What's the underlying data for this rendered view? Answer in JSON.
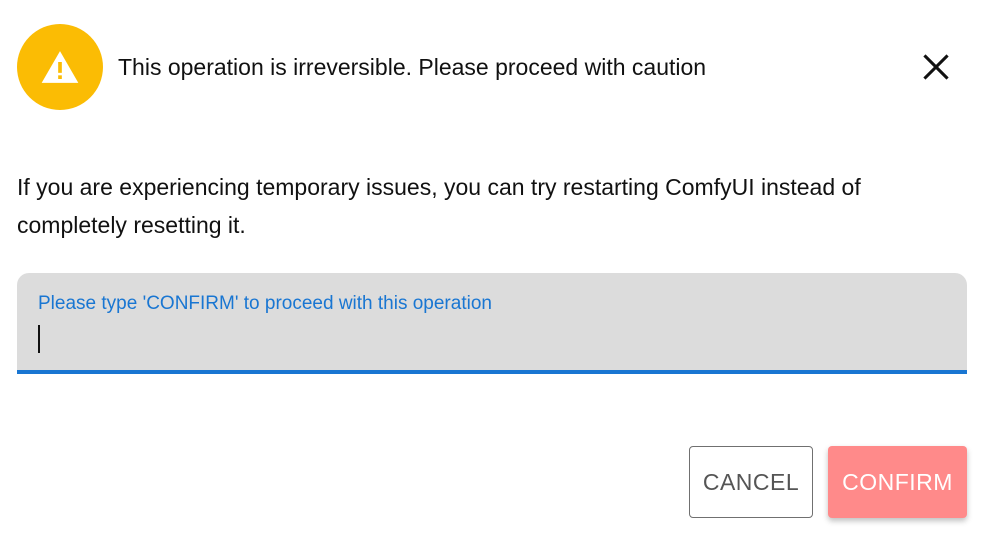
{
  "dialog": {
    "title": "This operation is irreversible. Please proceed with caution",
    "message": "If you are experiencing temporary issues, you can try restarting ComfyUI instead of completely resetting it.",
    "warning_icon": "warning-icon",
    "close_icon": "close-icon"
  },
  "confirm_field": {
    "label": "Please type 'CONFIRM' to proceed with this operation",
    "value": ""
  },
  "actions": {
    "cancel_label": "CANCEL",
    "confirm_label": "CONFIRM"
  },
  "colors": {
    "warning": "#fbbc04",
    "field_accent": "#1976d2",
    "field_background": "#dcdcdc",
    "confirm_disabled": "#ff8a8a"
  }
}
